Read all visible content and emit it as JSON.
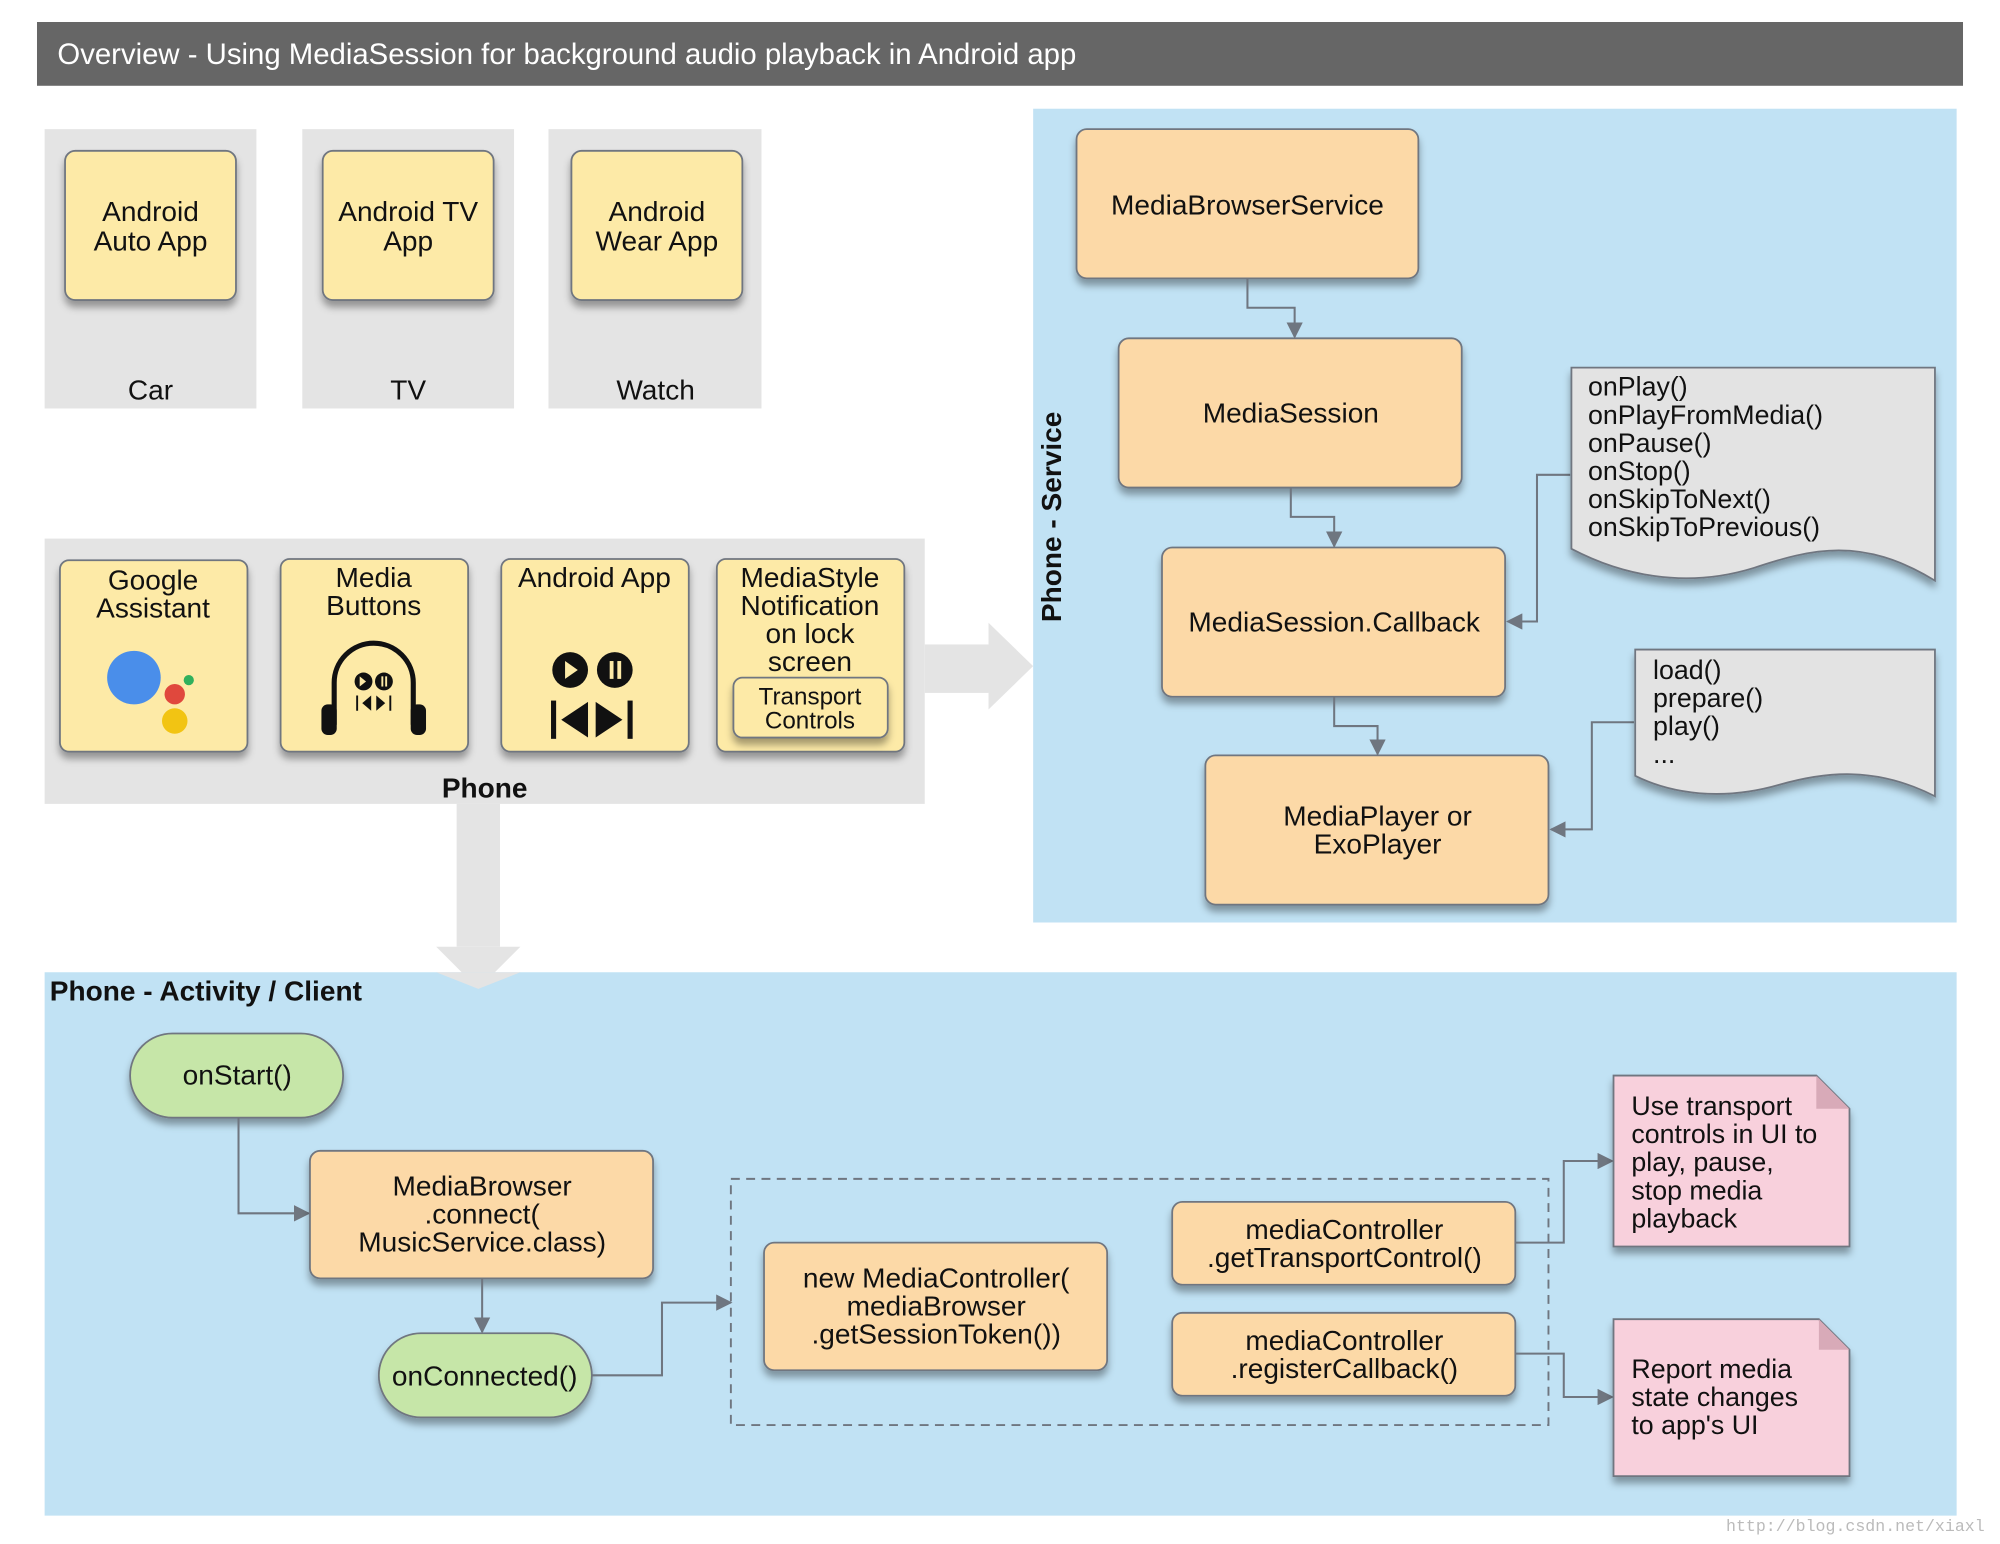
{
  "title": "Overview - Using MediaSession for background audio playback in Android app",
  "devices": [
    {
      "app": [
        "Android",
        "Auto App"
      ],
      "label": "Car"
    },
    {
      "app": [
        "Android TV",
        "App"
      ],
      "label": "TV"
    },
    {
      "app": [
        "Android",
        "Wear App"
      ],
      "label": "Watch"
    }
  ],
  "phone": {
    "label": "Phone",
    "items": [
      {
        "title": [
          "Google",
          "Assistant"
        ],
        "icon": "google-assistant-icon"
      },
      {
        "title": [
          "Media",
          "Buttons"
        ],
        "icon": "headphones-media-buttons-icon"
      },
      {
        "title": [
          "Android App"
        ],
        "icon": "play-pause-skip-icon"
      },
      {
        "title": [
          "MediaStyle",
          "Notification",
          "on lock",
          "screen"
        ],
        "sub": [
          "Transport",
          "Controls"
        ]
      }
    ]
  },
  "service": {
    "label": "Phone - Service",
    "browser_service": "MediaBrowserService",
    "session": "MediaSession",
    "callback": "MediaSession.Callback",
    "player": [
      "MediaPlayer or",
      "ExoPlayer"
    ],
    "callback_methods": [
      "onPlay()",
      "onPlayFromMedia()",
      "onPause()",
      "onStop()",
      "onSkipToNext()",
      "onSkipToPrevious()"
    ],
    "player_methods": [
      "load()",
      "prepare()",
      "play()",
      "..."
    ]
  },
  "client": {
    "label": "Phone - Activity / Client",
    "on_start": "onStart()",
    "connect": [
      "MediaBrowser",
      ".connect(",
      "MusicService.class)"
    ],
    "on_connected": "onConnected()",
    "new_controller": [
      "new MediaController(",
      "mediaBrowser",
      ".getSessionToken())"
    ],
    "transport": [
      "mediaController",
      ".getTransportControl()"
    ],
    "register": [
      "mediaController",
      ".registerCallback()"
    ],
    "note_transport": [
      "Use transport",
      "controls in UI to",
      "play, pause,",
      "stop media",
      "playback"
    ],
    "note_report": [
      "Report media",
      "state changes",
      "to app's UI"
    ]
  },
  "watermark": "http://blog.csdn.net/xiaxl",
  "colors": {
    "title_bar": "#666666",
    "panel_gray": "#e4e4e4",
    "panel_blue": "#c1e2f4",
    "yellow_box": "#fdeaa7",
    "orange_box": "#fcd9a7",
    "green_box": "#c6e6a8",
    "pink_note": "#f8d0dc",
    "gray_doc": "#e3e3e3"
  }
}
